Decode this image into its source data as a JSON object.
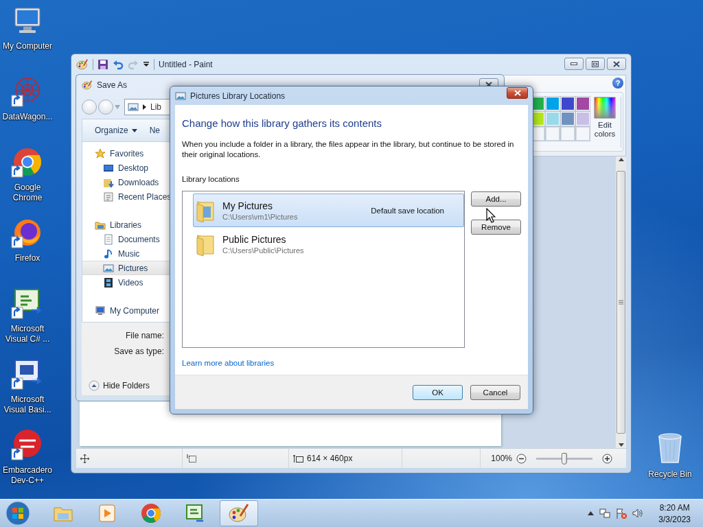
{
  "desktop_icons": [
    {
      "label": "My Computer",
      "kind": "computer",
      "shortcut": false
    },
    {
      "label": "DataWagon...",
      "kind": "datawagon",
      "shortcut": true
    },
    {
      "label": "Google Chrome",
      "kind": "chrome",
      "shortcut": true
    },
    {
      "label": "Firefox",
      "kind": "firefox",
      "shortcut": true
    },
    {
      "label": "Microsoft Visual C# ...",
      "kind": "csharp",
      "shortcut": true
    },
    {
      "label": "Microsoft Visual Basi...",
      "kind": "vb",
      "shortcut": true
    },
    {
      "label": "Embarcadero Dev-C++",
      "kind": "devcpp",
      "shortcut": true
    }
  ],
  "recycle_bin": {
    "label": "Recycle Bin"
  },
  "paint": {
    "title": "Untitled - Paint",
    "help": "?",
    "palette": [
      {
        "kind": "color",
        "color": "#22b14c"
      },
      {
        "kind": "color",
        "color": "#00a2e8"
      },
      {
        "kind": "color",
        "color": "#3f48cc"
      },
      {
        "kind": "color",
        "color": "#a349a4"
      },
      {
        "kind": "color",
        "color": "#b5e61d"
      },
      {
        "kind": "color",
        "color": "#99d9ea"
      },
      {
        "kind": "color",
        "color": "#7092be"
      },
      {
        "kind": "color",
        "color": "#c8bfe7"
      },
      {
        "kind": "empty"
      },
      {
        "kind": "empty"
      },
      {
        "kind": "empty"
      },
      {
        "kind": "empty"
      }
    ],
    "edit_colors": "Edit colors",
    "status": {
      "canvas_size": "614 × 460px",
      "zoom": "100%",
      "zoom_slider": {
        "level": 0.5
      }
    }
  },
  "save_as": {
    "title": "Save As",
    "address": "Lib",
    "toolbar": [
      {
        "label": "Organize",
        "dropdown": true
      },
      {
        "label": "Ne",
        "dropdown": false
      }
    ],
    "nav": [
      {
        "label": "Favorites",
        "kind": "favorites",
        "selected": false,
        "children": [
          {
            "label": "Desktop",
            "kind": "desktop",
            "selected": false
          },
          {
            "label": "Downloads",
            "kind": "downloads",
            "selected": false
          },
          {
            "label": "Recent Places",
            "kind": "recent",
            "selected": false
          }
        ]
      },
      {
        "label": "Libraries",
        "kind": "libraries",
        "selected": false,
        "children": [
          {
            "label": "Documents",
            "kind": "documents",
            "selected": false
          },
          {
            "label": "Music",
            "kind": "music",
            "selected": false
          },
          {
            "label": "Pictures",
            "kind": "pictures",
            "selected": true
          },
          {
            "label": "Videos",
            "kind": "videos",
            "selected": false
          }
        ]
      },
      {
        "label": "My Computer",
        "kind": "computer",
        "selected": false
      }
    ],
    "fields": [
      "File name:",
      "Save as type:"
    ],
    "hide_folders": "Hide Folders"
  },
  "library_dialog": {
    "title": "Pictures Library Locations",
    "heading": "Change how this library gathers its contents",
    "description": "When you include a folder in a library, the files appear in the library, but continue to be stored in their original locations.",
    "list_label": "Library locations",
    "locations": [
      {
        "name": "My Pictures",
        "path": "C:\\Users\\vm1\\Pictures",
        "note": "Default save location",
        "selected": true
      },
      {
        "name": "Public Pictures",
        "path": "C:\\Users\\Public\\Pictures",
        "selected": false
      }
    ],
    "side_buttons": [
      "Add...",
      "Remove"
    ],
    "link": "Learn more about libraries",
    "buttons": [
      {
        "label": "OK",
        "default": true
      },
      {
        "label": "Cancel",
        "default": false
      }
    ]
  },
  "taskbar": {
    "apps": [
      {
        "kind": "explorer",
        "active": false
      },
      {
        "kind": "media",
        "active": false
      },
      {
        "kind": "chrome",
        "active": false
      },
      {
        "kind": "csharp",
        "active": false
      },
      {
        "kind": "paint",
        "active": true
      }
    ],
    "time": "8:20 AM",
    "date": "3/3/2023"
  }
}
